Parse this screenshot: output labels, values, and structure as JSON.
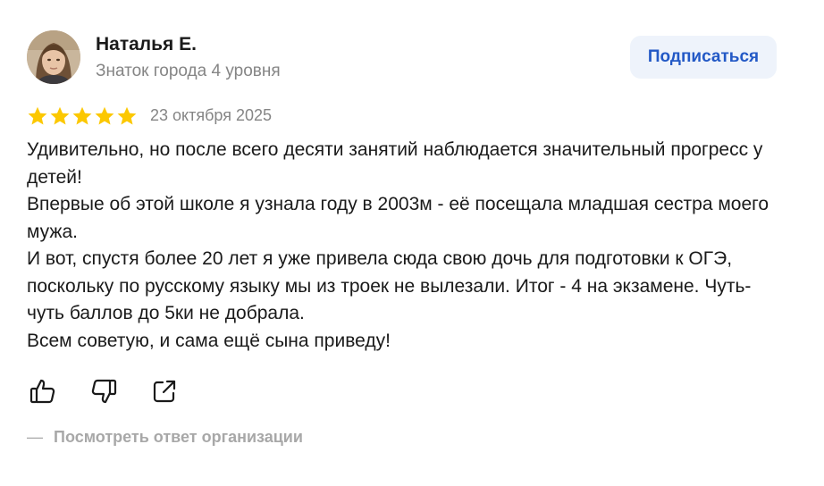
{
  "author": {
    "name": "Наталья Е.",
    "level": "Знаток города 4 уровня",
    "avatar_icon": "user-photo"
  },
  "subscribe_label": "Подписаться",
  "rating": {
    "value": 5,
    "max": 5,
    "star_color": "#fcc800"
  },
  "date": "23 октября 2025",
  "review": {
    "lines": [
      "Удивительно, но после всего десяти занятий наблюдается значительный прогресс у детей!",
      "Впервые об этой школе я узнала году в 2003м - её посещала младшая сестра моего мужа.",
      "И вот, спустя более 20 лет я уже привела сюда свою дочь для подготовки к ОГЭ, поскольку по русскому языку мы из троек не вылезали. Итог - 4 на экзамене. Чуть-чуть баллов до 5ки не добрала.",
      "Всем советую, и сама ещё сына приведу!"
    ]
  },
  "actions": {
    "like_icon": "thumbs-up-icon",
    "dislike_icon": "thumbs-down-icon",
    "share_icon": "share-icon"
  },
  "org_reply": {
    "dash": "—",
    "label": "Посмотреть ответ организации"
  },
  "colors": {
    "accent": "#2359c6",
    "subscribe_bg": "#eef3fb",
    "muted": "#858585"
  }
}
